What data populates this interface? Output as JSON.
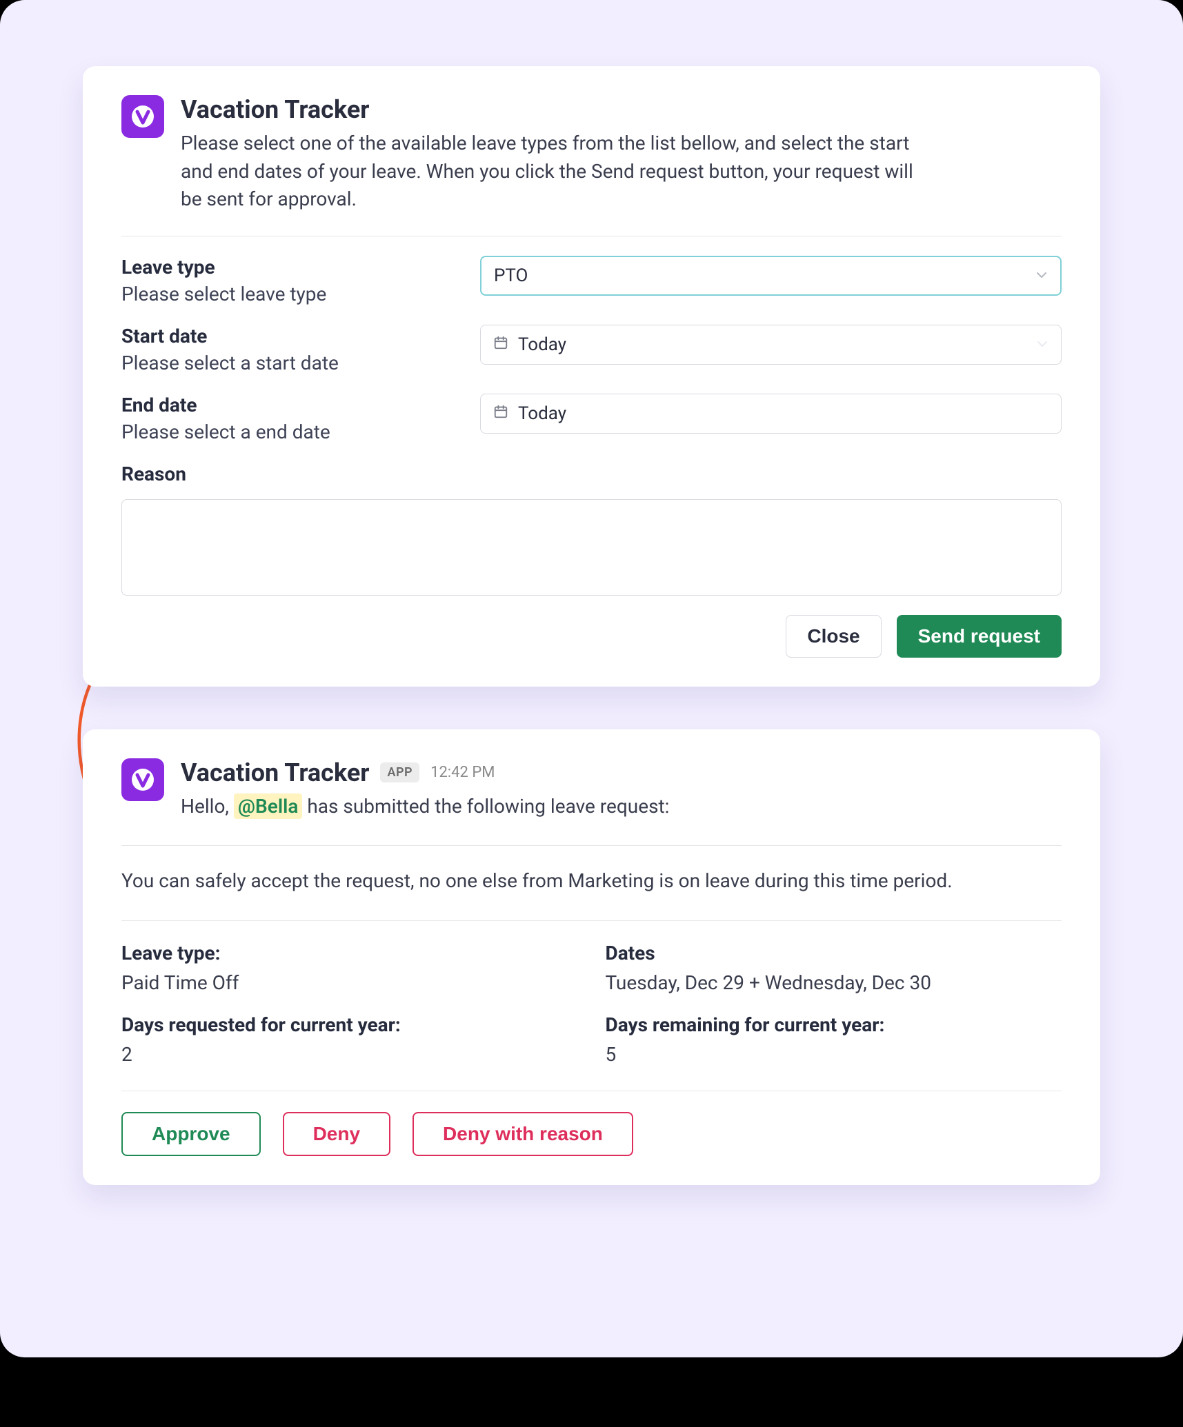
{
  "brand": {
    "accent_purple": "#8a2be2",
    "accent_green": "#1f8a55",
    "accent_red": "#de2e5c",
    "accent_teal": "#7fd0d8"
  },
  "request_card": {
    "app_title": "Vacation Tracker",
    "intro": "Please select one of the available leave types from the list bellow, and select the start and end dates of your leave. When you click the Send request button, your request will be sent for approval.",
    "fields": {
      "leave_type": {
        "label": "Leave type",
        "hint": "Please select leave type",
        "value": "PTO"
      },
      "start_date": {
        "label": "Start date",
        "hint": "Please select a start date",
        "value": "Today"
      },
      "end_date": {
        "label": "End date",
        "hint": "Please select a end date",
        "value": "Today"
      },
      "reason": {
        "label": "Reason",
        "value": ""
      }
    },
    "buttons": {
      "close": "Close",
      "send": "Send request"
    }
  },
  "message_card": {
    "app_title": "Vacation Tracker",
    "app_tag": "APP",
    "time": "12:42 PM",
    "greeting_prefix": "Hello, ",
    "mention": "@Bella",
    "greeting_suffix": " has submitted the following leave request:",
    "advice": "You can safely accept the request, no one else from Marketing is on leave during this time period.",
    "details": {
      "leave_type_label": "Leave type:",
      "leave_type_value": "Paid Time Off",
      "dates_label": "Dates",
      "dates_value": "Tuesday, Dec 29 + Wednesday, Dec 30",
      "days_requested_label": "Days requested for current year:",
      "days_requested_value": "2",
      "days_remaining_label": "Days remaining for current year:",
      "days_remaining_value": "5"
    },
    "buttons": {
      "approve": "Approve",
      "deny": "Deny",
      "deny_reason": "Deny with reason"
    }
  }
}
